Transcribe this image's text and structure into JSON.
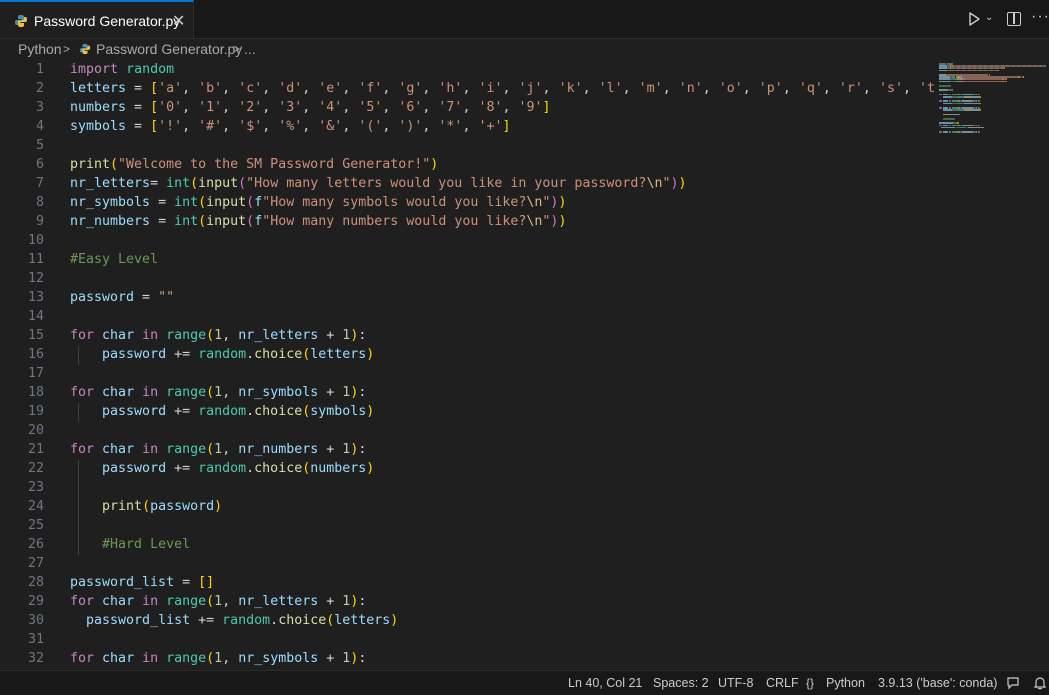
{
  "tab": {
    "title": "Password Generator.py",
    "close": "✕"
  },
  "toolbar": {
    "run": "run-icon",
    "more": "···"
  },
  "breadcrumb": {
    "root": "Python",
    "file": "Password Generator.py",
    "more": "..."
  },
  "code_lines": [
    {
      "n": "1",
      "segs": [
        [
          "kw",
          "import"
        ],
        [
          "op",
          " "
        ],
        [
          "mod",
          "random"
        ]
      ]
    },
    {
      "n": "2",
      "segs": [
        [
          "var",
          "letters"
        ],
        [
          "op",
          " = "
        ],
        [
          "br",
          "["
        ],
        [
          "str",
          "'a'"
        ],
        [
          "op",
          ", "
        ],
        [
          "str",
          "'b'"
        ],
        [
          "op",
          ", "
        ],
        [
          "str",
          "'c'"
        ],
        [
          "op",
          ", "
        ],
        [
          "str",
          "'d'"
        ],
        [
          "op",
          ", "
        ],
        [
          "str",
          "'e'"
        ],
        [
          "op",
          ", "
        ],
        [
          "str",
          "'f'"
        ],
        [
          "op",
          ", "
        ],
        [
          "str",
          "'g'"
        ],
        [
          "op",
          ", "
        ],
        [
          "str",
          "'h'"
        ],
        [
          "op",
          ", "
        ],
        [
          "str",
          "'i'"
        ],
        [
          "op",
          ", "
        ],
        [
          "str",
          "'j'"
        ],
        [
          "op",
          ", "
        ],
        [
          "str",
          "'k'"
        ],
        [
          "op",
          ", "
        ],
        [
          "str",
          "'l'"
        ],
        [
          "op",
          ", "
        ],
        [
          "str",
          "'m'"
        ],
        [
          "op",
          ", "
        ],
        [
          "str",
          "'n'"
        ],
        [
          "op",
          ", "
        ],
        [
          "str",
          "'o'"
        ],
        [
          "op",
          ", "
        ],
        [
          "str",
          "'p'"
        ],
        [
          "op",
          ", "
        ],
        [
          "str",
          "'q'"
        ],
        [
          "op",
          ", "
        ],
        [
          "str",
          "'r'"
        ],
        [
          "op",
          ", "
        ],
        [
          "str",
          "'s'"
        ],
        [
          "op",
          ", "
        ],
        [
          "str",
          "'t'"
        ],
        [
          "op",
          ", "
        ],
        [
          "str",
          "'"
        ]
      ]
    },
    {
      "n": "3",
      "segs": [
        [
          "var",
          "numbers"
        ],
        [
          "op",
          " = "
        ],
        [
          "br",
          "["
        ],
        [
          "str",
          "'0'"
        ],
        [
          "op",
          ", "
        ],
        [
          "str",
          "'1'"
        ],
        [
          "op",
          ", "
        ],
        [
          "str",
          "'2'"
        ],
        [
          "op",
          ", "
        ],
        [
          "str",
          "'3'"
        ],
        [
          "op",
          ", "
        ],
        [
          "str",
          "'4'"
        ],
        [
          "op",
          ", "
        ],
        [
          "str",
          "'5'"
        ],
        [
          "op",
          ", "
        ],
        [
          "str",
          "'6'"
        ],
        [
          "op",
          ", "
        ],
        [
          "str",
          "'7'"
        ],
        [
          "op",
          ", "
        ],
        [
          "str",
          "'8'"
        ],
        [
          "op",
          ", "
        ],
        [
          "str",
          "'9'"
        ],
        [
          "br",
          "]"
        ]
      ]
    },
    {
      "n": "4",
      "segs": [
        [
          "var",
          "symbols"
        ],
        [
          "op",
          " = "
        ],
        [
          "br",
          "["
        ],
        [
          "str",
          "'!'"
        ],
        [
          "op",
          ", "
        ],
        [
          "str",
          "'#'"
        ],
        [
          "op",
          ", "
        ],
        [
          "str",
          "'$'"
        ],
        [
          "op",
          ", "
        ],
        [
          "str",
          "'%'"
        ],
        [
          "op",
          ", "
        ],
        [
          "str",
          "'&'"
        ],
        [
          "op",
          ", "
        ],
        [
          "str",
          "'('"
        ],
        [
          "op",
          ", "
        ],
        [
          "str",
          "')'"
        ],
        [
          "op",
          ", "
        ],
        [
          "str",
          "'*'"
        ],
        [
          "op",
          ", "
        ],
        [
          "str",
          "'+'"
        ],
        [
          "br",
          "]"
        ]
      ]
    },
    {
      "n": "5",
      "segs": []
    },
    {
      "n": "6",
      "segs": [
        [
          "fn",
          "print"
        ],
        [
          "br",
          "("
        ],
        [
          "str",
          "\"Welcome to the SM Password Generator!\""
        ],
        [
          "br",
          ")"
        ]
      ]
    },
    {
      "n": "7",
      "segs": [
        [
          "var",
          "nr_letters"
        ],
        [
          "op",
          "= "
        ],
        [
          "mod",
          "int"
        ],
        [
          "br",
          "("
        ],
        [
          "fn",
          "input"
        ],
        [
          "br2",
          "("
        ],
        [
          "str",
          "\"How many letters would you like in your password?"
        ],
        [
          "esc",
          "\\n"
        ],
        [
          "str",
          "\""
        ],
        [
          "br2",
          ")"
        ],
        [
          "br",
          ")"
        ]
      ]
    },
    {
      "n": "8",
      "segs": [
        [
          "var",
          "nr_symbols"
        ],
        [
          "op",
          " = "
        ],
        [
          "mod",
          "int"
        ],
        [
          "br",
          "("
        ],
        [
          "fn",
          "input"
        ],
        [
          "br2",
          "("
        ],
        [
          "var",
          "f"
        ],
        [
          "str",
          "\"How many symbols would you like?"
        ],
        [
          "esc",
          "\\n"
        ],
        [
          "str",
          "\""
        ],
        [
          "br2",
          ")"
        ],
        [
          "br",
          ")"
        ]
      ]
    },
    {
      "n": "9",
      "segs": [
        [
          "var",
          "nr_numbers"
        ],
        [
          "op",
          " = "
        ],
        [
          "mod",
          "int"
        ],
        [
          "br",
          "("
        ],
        [
          "fn",
          "input"
        ],
        [
          "br2",
          "("
        ],
        [
          "var",
          "f"
        ],
        [
          "str",
          "\"How many numbers would you like?"
        ],
        [
          "esc",
          "\\n"
        ],
        [
          "str",
          "\""
        ],
        [
          "br2",
          ")"
        ],
        [
          "br",
          ")"
        ]
      ]
    },
    {
      "n": "10",
      "segs": []
    },
    {
      "n": "11",
      "segs": [
        [
          "cmt",
          "#Easy Level"
        ]
      ]
    },
    {
      "n": "12",
      "segs": []
    },
    {
      "n": "13",
      "segs": [
        [
          "var",
          "password"
        ],
        [
          "op",
          " = "
        ],
        [
          "str",
          "\"\""
        ]
      ]
    },
    {
      "n": "14",
      "segs": []
    },
    {
      "n": "15",
      "segs": [
        [
          "kw",
          "for"
        ],
        [
          "op",
          " "
        ],
        [
          "var",
          "char"
        ],
        [
          "op",
          " "
        ],
        [
          "kw",
          "in"
        ],
        [
          "op",
          " "
        ],
        [
          "mod",
          "range"
        ],
        [
          "br",
          "("
        ],
        [
          "num",
          "1"
        ],
        [
          "op",
          ", "
        ],
        [
          "var",
          "nr_letters"
        ],
        [
          "op",
          " + "
        ],
        [
          "num",
          "1"
        ],
        [
          "br",
          ")"
        ],
        [
          "op",
          ":"
        ]
      ]
    },
    {
      "n": "16",
      "segs": [
        [
          "op",
          "    "
        ],
        [
          "var",
          "password"
        ],
        [
          "op",
          " += "
        ],
        [
          "mod",
          "random"
        ],
        [
          "op",
          "."
        ],
        [
          "fn",
          "choice"
        ],
        [
          "br",
          "("
        ],
        [
          "var",
          "letters"
        ],
        [
          "br",
          ")"
        ]
      ]
    },
    {
      "n": "17",
      "segs": []
    },
    {
      "n": "18",
      "segs": [
        [
          "kw",
          "for"
        ],
        [
          "op",
          " "
        ],
        [
          "var",
          "char"
        ],
        [
          "op",
          " "
        ],
        [
          "kw",
          "in"
        ],
        [
          "op",
          " "
        ],
        [
          "mod",
          "range"
        ],
        [
          "br",
          "("
        ],
        [
          "num",
          "1"
        ],
        [
          "op",
          ", "
        ],
        [
          "var",
          "nr_symbols"
        ],
        [
          "op",
          " + "
        ],
        [
          "num",
          "1"
        ],
        [
          "br",
          ")"
        ],
        [
          "op",
          ":"
        ]
      ]
    },
    {
      "n": "19",
      "segs": [
        [
          "op",
          "    "
        ],
        [
          "var",
          "password"
        ],
        [
          "op",
          " += "
        ],
        [
          "mod",
          "random"
        ],
        [
          "op",
          "."
        ],
        [
          "fn",
          "choice"
        ],
        [
          "br",
          "("
        ],
        [
          "var",
          "symbols"
        ],
        [
          "br",
          ")"
        ]
      ]
    },
    {
      "n": "20",
      "segs": []
    },
    {
      "n": "21",
      "segs": [
        [
          "kw",
          "for"
        ],
        [
          "op",
          " "
        ],
        [
          "var",
          "char"
        ],
        [
          "op",
          " "
        ],
        [
          "kw",
          "in"
        ],
        [
          "op",
          " "
        ],
        [
          "mod",
          "range"
        ],
        [
          "br",
          "("
        ],
        [
          "num",
          "1"
        ],
        [
          "op",
          ", "
        ],
        [
          "var",
          "nr_numbers"
        ],
        [
          "op",
          " + "
        ],
        [
          "num",
          "1"
        ],
        [
          "br",
          ")"
        ],
        [
          "op",
          ":"
        ]
      ]
    },
    {
      "n": "22",
      "segs": [
        [
          "op",
          "    "
        ],
        [
          "var",
          "password"
        ],
        [
          "op",
          " += "
        ],
        [
          "mod",
          "random"
        ],
        [
          "op",
          "."
        ],
        [
          "fn",
          "choice"
        ],
        [
          "br",
          "("
        ],
        [
          "var",
          "numbers"
        ],
        [
          "br",
          ")"
        ]
      ]
    },
    {
      "n": "23",
      "segs": []
    },
    {
      "n": "24",
      "segs": [
        [
          "op",
          "    "
        ],
        [
          "fn",
          "print"
        ],
        [
          "br",
          "("
        ],
        [
          "var",
          "password"
        ],
        [
          "br",
          ")"
        ]
      ]
    },
    {
      "n": "25",
      "segs": []
    },
    {
      "n": "26",
      "segs": [
        [
          "op",
          "    "
        ],
        [
          "cmt",
          "#Hard Level"
        ]
      ]
    },
    {
      "n": "27",
      "segs": []
    },
    {
      "n": "28",
      "segs": [
        [
          "var",
          "password_list"
        ],
        [
          "op",
          " = "
        ],
        [
          "br",
          "[]"
        ]
      ]
    },
    {
      "n": "29",
      "segs": [
        [
          "kw",
          "for"
        ],
        [
          "op",
          " "
        ],
        [
          "var",
          "char"
        ],
        [
          "op",
          " "
        ],
        [
          "kw",
          "in"
        ],
        [
          "op",
          " "
        ],
        [
          "mod",
          "range"
        ],
        [
          "br",
          "("
        ],
        [
          "num",
          "1"
        ],
        [
          "op",
          ", "
        ],
        [
          "var",
          "nr_letters"
        ],
        [
          "op",
          " + "
        ],
        [
          "num",
          "1"
        ],
        [
          "br",
          ")"
        ],
        [
          "op",
          ":"
        ]
      ]
    },
    {
      "n": "30",
      "segs": [
        [
          "op",
          "  "
        ],
        [
          "var",
          "password_list"
        ],
        [
          "op",
          " += "
        ],
        [
          "mod",
          "random"
        ],
        [
          "op",
          "."
        ],
        [
          "fn",
          "choice"
        ],
        [
          "br",
          "("
        ],
        [
          "var",
          "letters"
        ],
        [
          "br",
          ")"
        ]
      ]
    },
    {
      "n": "31",
      "segs": []
    },
    {
      "n": "32",
      "segs": [
        [
          "kw",
          "for"
        ],
        [
          "op",
          " "
        ],
        [
          "var",
          "char"
        ],
        [
          "op",
          " "
        ],
        [
          "kw",
          "in"
        ],
        [
          "op",
          " "
        ],
        [
          "mod",
          "range"
        ],
        [
          "br",
          "("
        ],
        [
          "num",
          "1"
        ],
        [
          "op",
          ", "
        ],
        [
          "var",
          "nr_symbols"
        ],
        [
          "op",
          " + "
        ],
        [
          "num",
          "1"
        ],
        [
          "br",
          ")"
        ],
        [
          "op",
          ":"
        ]
      ]
    }
  ],
  "status": {
    "position": "Ln 40, Col 21",
    "spaces": "Spaces: 2",
    "encoding": "UTF-8",
    "eol": "CRLF",
    "language": "Python",
    "interpreter": "3.9.13 ('base': conda)"
  },
  "colors": {
    "accent": "#0078d4",
    "background": "#1f1f1f",
    "chrome": "#181818"
  }
}
